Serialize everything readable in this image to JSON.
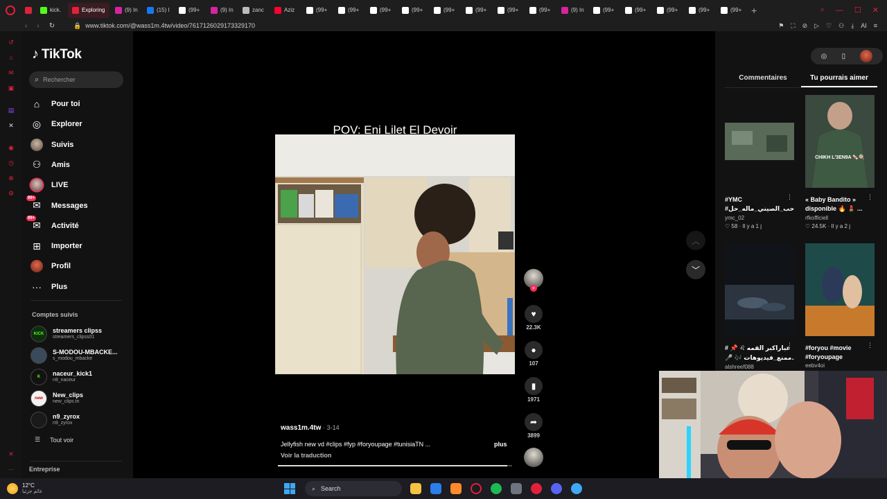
{
  "browser": {
    "tabs": [
      {
        "label": "",
        "color": "#e1213b"
      },
      {
        "label": "kick.",
        "color": "#53fc18"
      },
      {
        "label": "Exploring",
        "color": "#e1213b",
        "active": true
      },
      {
        "label": "(9) In",
        "color": "#d6249f"
      },
      {
        "label": "(15) I",
        "color": "#1877f2"
      },
      {
        "label": "(99+",
        "color": "#ffffff"
      },
      {
        "label": "(9) In",
        "color": "#d6249f"
      },
      {
        "label": "zanc",
        "color": "#bbbbbb"
      },
      {
        "label": "Aziz",
        "color": "#ff0033"
      },
      {
        "label": "(99+",
        "color": "#ffffff"
      },
      {
        "label": "(99+",
        "color": "#ffffff"
      },
      {
        "label": "(99+",
        "color": "#ffffff"
      },
      {
        "label": "(99+",
        "color": "#ffffff"
      },
      {
        "label": "(99+",
        "color": "#ffffff"
      },
      {
        "label": "(99+",
        "color": "#ffffff"
      },
      {
        "label": "(99+",
        "color": "#ffffff"
      },
      {
        "label": "(99+",
        "color": "#ffffff"
      },
      {
        "label": "(9) In",
        "color": "#d6249f"
      },
      {
        "label": "(99+",
        "color": "#ffffff"
      },
      {
        "label": "(99+",
        "color": "#ffffff"
      },
      {
        "label": "(99+",
        "color": "#ffffff"
      },
      {
        "label": "(99+",
        "color": "#ffffff"
      },
      {
        "label": "(99+",
        "color": "#ffffff"
      }
    ],
    "url": "www.tiktok.com/@wass1m.4tw/video/7617126029173329170",
    "ai_label": "AI"
  },
  "tiktok": {
    "logo_text": "TikTok",
    "search_placeholder": "Rechercher",
    "nav": [
      {
        "label": "Pour toi",
        "icon": "home-icon"
      },
      {
        "label": "Explorer",
        "icon": "compass-icon"
      },
      {
        "label": "Suivis",
        "icon": "avatar-icon"
      },
      {
        "label": "Amis",
        "icon": "friends-icon"
      },
      {
        "label": "LIVE",
        "icon": "live-icon"
      },
      {
        "label": "Messages",
        "icon": "messages-icon",
        "badge": "99+"
      },
      {
        "label": "Activité",
        "icon": "activity-icon",
        "badge": "99+"
      },
      {
        "label": "Importer",
        "icon": "upload-icon"
      },
      {
        "label": "Profil",
        "icon": "profile-icon"
      },
      {
        "label": "Plus",
        "icon": "more-icon"
      }
    ],
    "following_title": "Comptes suivis",
    "following": [
      {
        "name": "streamers clipss",
        "handle": "streamers_clipss01",
        "color": "#0f2d10",
        "tag": "KICK",
        "tagColor": "#53fc18"
      },
      {
        "name": "S-MODOU-MBACKE...",
        "handle": "s_modou_mbacke",
        "color": "#3a4a5a",
        "tag": "",
        "tagColor": "#fff"
      },
      {
        "name": "naceur_kick1",
        "handle": "n9_naceur",
        "color": "#121212",
        "tag": "K",
        "tagColor": "#53fc18"
      },
      {
        "name": "New_clips",
        "handle": "new_clips.tn",
        "color": "#f2f2f2",
        "tag": "new",
        "tagColor": "#c00"
      },
      {
        "name": "n9_zyrox",
        "handle": "n9_zyrox",
        "color": "#1a1a1a",
        "tag": "",
        "tagColor": "#fff"
      }
    ],
    "see_all": "Tout voir",
    "enterprise": "Entreprise"
  },
  "video": {
    "title": "POV: Eni Lilet El Devoir",
    "author": "wass1m.4tw",
    "date": "3-14",
    "caption": "Jellyfish new vd #clips #fyp #foryoupage #tunisiaTN ...",
    "more_label": "plus",
    "translate_label": "Voir la traduction",
    "progress": 0.98,
    "likes": "22.3K",
    "comments": "107",
    "saves": "1971",
    "shares": "3899"
  },
  "right_panel": {
    "tab_comments": "Commentaires",
    "tab_suggested": "Tu pourrais aimer",
    "cards": [
      {
        "cap1": "#YMC",
        "cap2": "#حب_الصيني_ماله_حل...",
        "by": "ymc_02",
        "likes": "58",
        "age": "Il y a 1 j",
        "overlay": ""
      },
      {
        "cap1": "« Baby Bandito »",
        "cap2": "disponible 🔥 💄 ...",
        "by": "rfkofficiell",
        "likes": "24.5K",
        "age": "Il y a 2 j",
        "overlay": "CHIKH L'3EN9A 🍬🍭"
      },
      {
        "cap1": "# 📌 ♌ عباراكبر القمه",
        "cap2": "🎤 🎶 ممنع_فيديوهات...",
        "by": "alshreef088",
        "likes": "",
        "age": "",
        "overlay": ""
      },
      {
        "cap1": "#foryou #movie",
        "cap2": "#foryoupage",
        "by": "eebv4oi",
        "likes": "",
        "age": "",
        "overlay": ""
      }
    ]
  },
  "taskbar": {
    "temp": "12°C",
    "location": "غائم جزئيا",
    "search_label": "Search",
    "apps": [
      "#f5c242",
      "#2b7de9",
      "#ff8a2b",
      "#e1213b",
      "#1db954",
      "#6f7580",
      "#e1213b",
      "#5865f2",
      "#3ea8f5"
    ]
  }
}
